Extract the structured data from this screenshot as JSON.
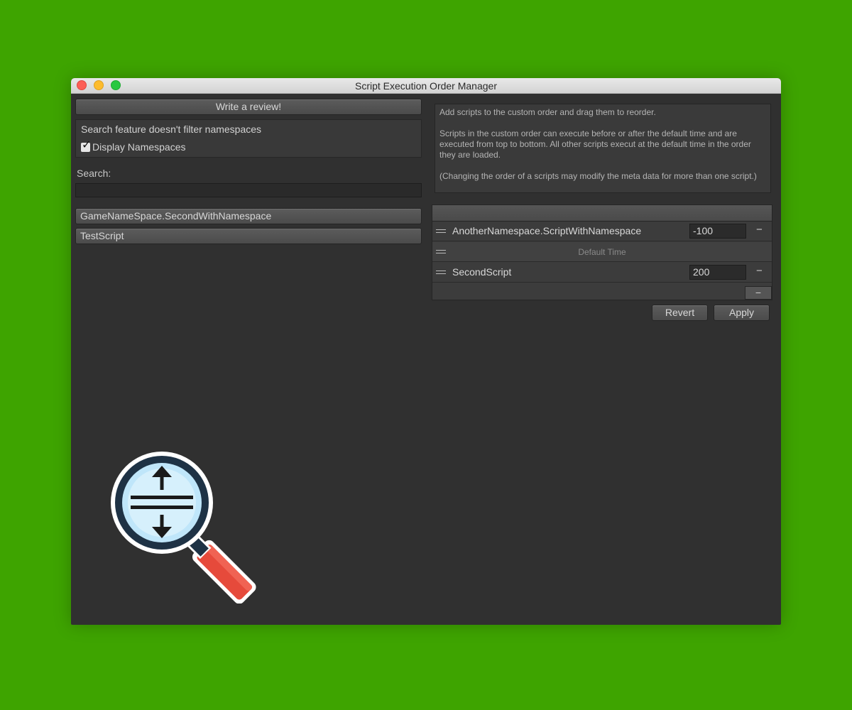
{
  "window": {
    "title": "Script Execution Order Manager"
  },
  "left_panel": {
    "review_button": "Write a review!",
    "namespace_info": "Search feature doesn't filter namespaces",
    "display_namespaces_label": "Display Namespaces",
    "display_namespaces_checked": true,
    "search_label": "Search:",
    "search_value": "",
    "scripts": [
      "GameNameSpace.SecondWithNamespace",
      "TestScript"
    ]
  },
  "right_panel": {
    "help_lines": [
      "Add scripts to the custom order and drag them to reorder.",
      "Scripts in the custom order can execute before or after the default time and are executed from top to bottom. All other scripts execut at the default time in the order they are loaded.",
      "(Changing the order of a scripts may modify the meta data for more than one script.)"
    ],
    "order_rows": [
      {
        "name": "AnotherNamespace.ScriptWithNamespace",
        "value": "-100"
      },
      {
        "name": "Default Time"
      },
      {
        "name": "SecondScript",
        "value": "200"
      }
    ],
    "remove_symbol": "−",
    "revert_button": "Revert",
    "apply_button": "Apply"
  },
  "colors": {
    "background": "#3ea400",
    "window": "#303030",
    "badge_ring": "#1e3245",
    "badge_lens": "#bfe6fa",
    "badge_handle": "#e64a3b"
  },
  "icons": {
    "badge": "magnifier-reorder-icon",
    "row_handle": "drag-handle-icon"
  }
}
